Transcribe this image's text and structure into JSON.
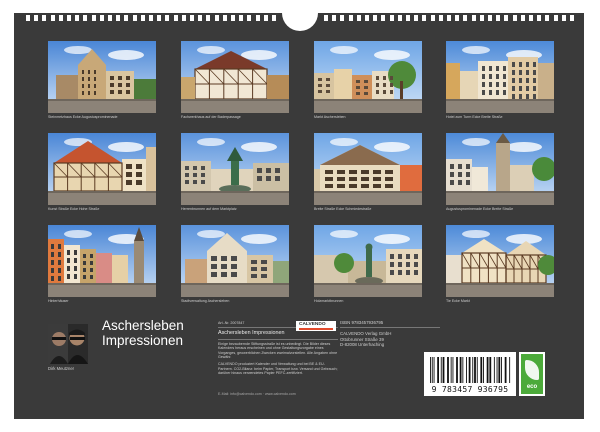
{
  "thumbnails": [
    {
      "caption": "Steinmetzhaus Ecke Augustusprominenade",
      "scene": "facade-gable-blue-sky"
    },
    {
      "caption": "Fachwerkhaus auf der Baderpassage",
      "scene": "timber-frame-house"
    },
    {
      "caption": "Markt Aschersleben",
      "scene": "market-square"
    },
    {
      "caption": "Hotel zum Turm Ecke Breite Straße",
      "scene": "street-row"
    },
    {
      "caption": "Kunst Straße Ecke Hohe Straße",
      "scene": "corner-house-red-roof"
    },
    {
      "caption": "Herrenbrunnen auf dem Marktplatz",
      "scene": "fountain-square"
    },
    {
      "caption": "Breite Straße Ecke Schmiedestraße",
      "scene": "classical-building"
    },
    {
      "caption": "Augustusprominenade Ecke Breite Straße",
      "scene": "church-tower-street"
    },
    {
      "caption": "Hinterhäuser",
      "scene": "colorful-row-church"
    },
    {
      "caption": "Stadtverwaltung Aschersleben",
      "scene": "town-hall"
    },
    {
      "caption": "Holzmarktbrunnen",
      "scene": "fountain-statue"
    },
    {
      "caption": "Tie Ecke Markt",
      "scene": "timber-row-square"
    }
  ],
  "author": {
    "name": "Dirk Meutzner"
  },
  "title_line1": "Aschersleben",
  "title_line2": "Impressionen",
  "article_no": "Art.-Nr. 2007847",
  "isbn": "ISBN 9783457936795",
  "info_title": "Aschersleben Impressionen",
  "info_body_1": "Einige bezaubernde Stiftungsstraße ist es unbedingt. Die Bilder dieses Kalenders heraus erscheinen und ohne Gestaltungsvorgabe eines Vorganges, geowerblichen Zwecken zweimalvorstellen. Alle Angaben ohne Gewähr.",
  "info_body_2": "CALVENDO produziert Kalender und Verwaltung und bei BE & EU-Partnern. CO2-Bilanz: beim Papier, Transport bzw. Versand und Gebrauch; darüber hinaus verwendetes Papier PEFC-zertifiziert.",
  "calvendo_label": "CALVENDO",
  "publisher": [
    "CALVENDO Verlag GmbH",
    "Ottobrunner Straße 39",
    "D-82008 Unterhaching"
  ],
  "barcode_number": "9 783457 936795",
  "eco_label": "eco",
  "footer_line": "E-Mail: info@calvendo.com · www.calvendo.com"
}
